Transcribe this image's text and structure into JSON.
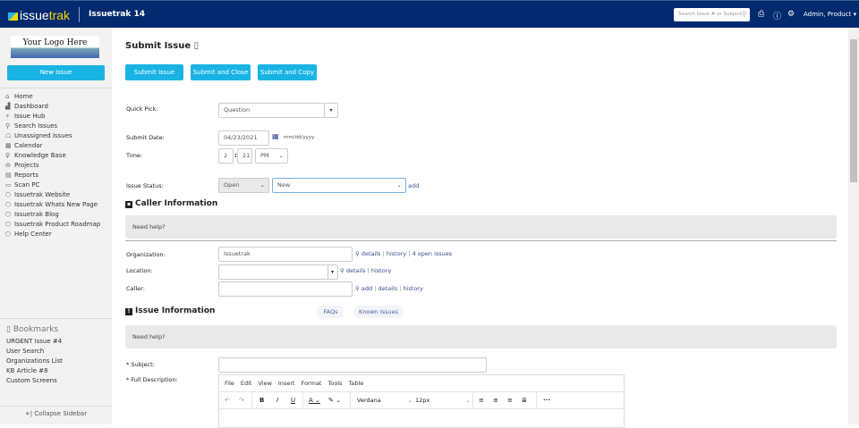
{
  "header": {
    "logo_text": "issuetrak",
    "app_title": "Issuetrak 14",
    "search_placeholder": "Search Issue # or Subject",
    "user": "Admin, Product ▾",
    "icons": [
      "print-icon",
      "help-icon",
      "gear-icon"
    ]
  },
  "sidebar": {
    "logo_text": "Your Logo Here",
    "new_issue": "New Issue",
    "items": [
      {
        "label": "Home",
        "icon": "⌂"
      },
      {
        "label": "Dashboard",
        "icon": "▟"
      },
      {
        "label": "Issue Hub",
        "icon": "⚡"
      },
      {
        "label": "Search Issues",
        "icon": "⚲"
      },
      {
        "label": "Unassigned Issues",
        "icon": "☖"
      },
      {
        "label": "Calendar",
        "icon": "▦"
      },
      {
        "label": "Knowledge Base",
        "icon": "♀"
      },
      {
        "label": "Projects",
        "icon": "ılı"
      },
      {
        "label": "Reports",
        "icon": "▤"
      },
      {
        "label": "Scan PC",
        "icon": "▭"
      },
      {
        "label": "Issuetrak Website",
        "icon": "⬡"
      },
      {
        "label": "Issuetrak Whats New Page",
        "icon": "⬡"
      },
      {
        "label": "Issuetrak Blog",
        "icon": "⬡"
      },
      {
        "label": "Issuetrak Product Roadmap",
        "icon": "⬡"
      },
      {
        "label": "Help Center",
        "icon": "⬡"
      }
    ],
    "bookmarks_title": "Bookmarks",
    "bookmarks": [
      "URGENT Issue #4",
      "User Search",
      "Organizations List",
      "KB Article #8",
      "Custom Screens"
    ],
    "collapse": "+| Collapse Sidebar"
  },
  "main": {
    "title": "Submit Issue",
    "buttons": [
      "Submit Issue",
      "Submit and Close",
      "Submit and Copy"
    ],
    "quick_pick": {
      "label": "Quick Pick:",
      "value": "Question"
    },
    "submit_date": {
      "label": "Submit Date:",
      "value": "04/23/2021",
      "format": "mm/dd/yyyy"
    },
    "time": {
      "label": "Time:",
      "hour": "2",
      "minute": "21",
      "ampm": "PM"
    },
    "issue_status": {
      "label": "Issue Status:",
      "status": "Open",
      "substatus": "New",
      "add": "add"
    },
    "caller_section": "Caller Information",
    "need_help": "Need help?",
    "organization": {
      "label": "Organization:",
      "value": "Issuetrak",
      "links": [
        "details",
        "history",
        "4 open issues"
      ]
    },
    "location": {
      "label": "Location:",
      "value": "",
      "links": [
        "details",
        "history"
      ]
    },
    "caller": {
      "label": "Caller:",
      "value": "",
      "links": [
        "add",
        "details",
        "history"
      ]
    },
    "issue_section": "Issue Information",
    "faqs": "FAQs",
    "known_issues": "Known Issues",
    "subject": {
      "label": "* Subject:",
      "value": ""
    },
    "description": {
      "label": "* Full Description:",
      "menu": [
        "File",
        "Edit",
        "View",
        "Insert",
        "Format",
        "Tools",
        "Table"
      ],
      "font": "Verdana",
      "size": "12px"
    }
  }
}
